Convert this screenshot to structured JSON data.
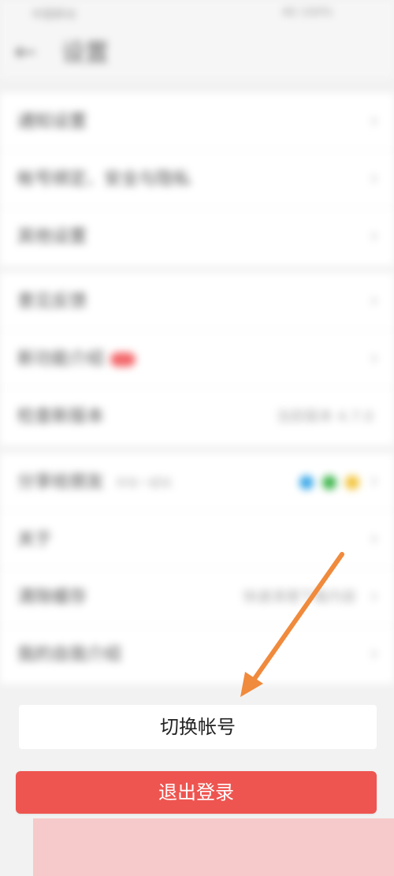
{
  "status_bar": {
    "left": "中国移动",
    "right": "4G 100%"
  },
  "header": {
    "back_icon": "back-arrow-icon",
    "title": "设置"
  },
  "sections": [
    {
      "rows": [
        {
          "label": "通知设置",
          "icon": "chevron-right-icon"
        },
        {
          "label": "帐号绑定、安全与隐私",
          "icon": "chevron-right-icon"
        },
        {
          "label": "其他设置",
          "icon": "chevron-right-icon"
        }
      ]
    },
    {
      "rows": [
        {
          "label": "意见反馈",
          "icon": "chevron-right-icon"
        },
        {
          "label": "新功能介绍",
          "badge": "new-badge",
          "icon": "chevron-right-icon"
        },
        {
          "label": "检查新版本",
          "value": "当前版本 4.7.0"
        }
      ]
    },
    {
      "rows": [
        {
          "label": "分享给朋友",
          "sub": "好友一起玩",
          "share_colors": [
            "#3aa8e8",
            "#3cb44a",
            "#f2c43a"
          ],
          "icon": "chevron-right-icon"
        },
        {
          "label": "关于",
          "icon": "chevron-right-icon"
        },
        {
          "label": "清除缓存",
          "value": "快速清理下载内容",
          "icon": "chevron-right-icon"
        },
        {
          "label": "我的自我介绍",
          "icon": "chevron-right-icon"
        }
      ]
    }
  ],
  "buttons": {
    "switch_account": "切换帐号",
    "logout": "退出登录"
  },
  "colors": {
    "logout_bg": "#ee5550",
    "annotation_arrow": "#f08a3c",
    "pink_overlay": "#f6caca"
  },
  "annotation": {
    "icon": "arrow-pointer-icon"
  }
}
